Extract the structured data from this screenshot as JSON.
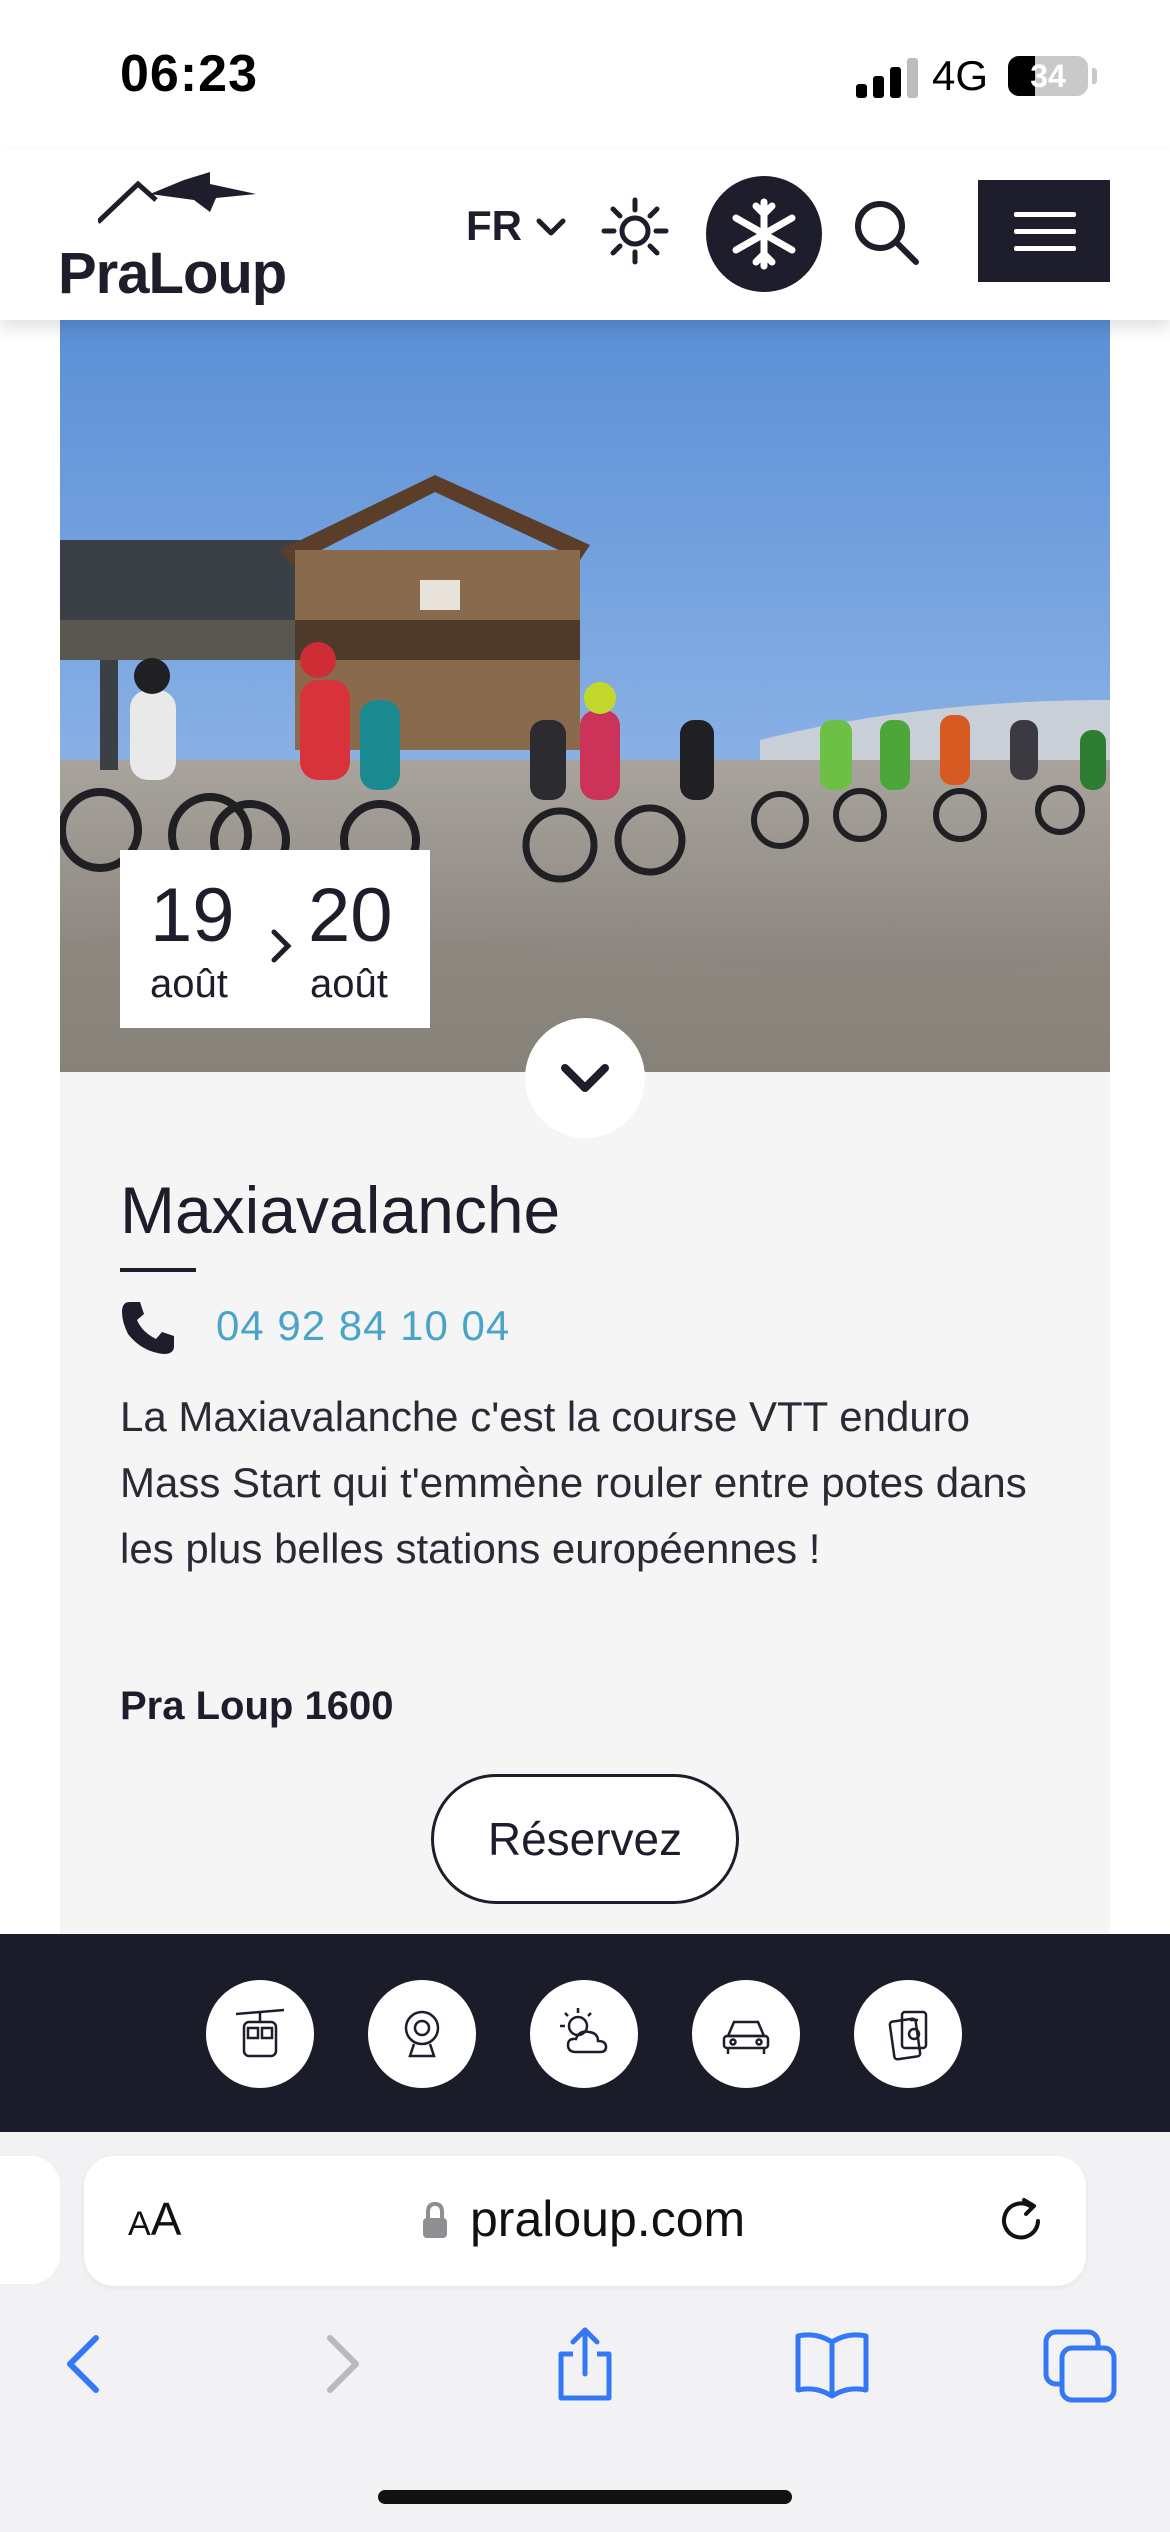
{
  "status_bar": {
    "time": "06:23",
    "network": "4G",
    "battery_level": "34",
    "battery_fraction": 0.34
  },
  "header": {
    "logo_text": "PraLoup",
    "language": "FR",
    "icons": [
      "sun-icon",
      "snowflake-icon",
      "search-icon",
      "hamburger-menu-icon"
    ]
  },
  "event": {
    "date_start_day": "19",
    "date_start_month": "août",
    "date_end_day": "20",
    "date_end_month": "août",
    "title": "Maxiavalanche",
    "phone": "04 92 84 10 04",
    "description": "La Maxiavalanche c'est la course VTT enduro Mass Start qui t'emmène rouler entre potes dans les plus belles stations européennes !",
    "location": "Pra Loup 1600",
    "cta_label": "Réservez"
  },
  "quick_bar": {
    "items": [
      "gondola-icon",
      "webcam-icon",
      "weather-icon",
      "car-icon",
      "ski-pass-icon"
    ]
  },
  "safari": {
    "aa_label_small": "A",
    "aa_label_large": "A",
    "url": "praloup.com"
  },
  "colors": {
    "brand_dark": "#1d1d2b",
    "quick_bar_bg": "#1a1c29",
    "link_blue": "#4aa3c8",
    "ios_blue": "#3478f6"
  }
}
